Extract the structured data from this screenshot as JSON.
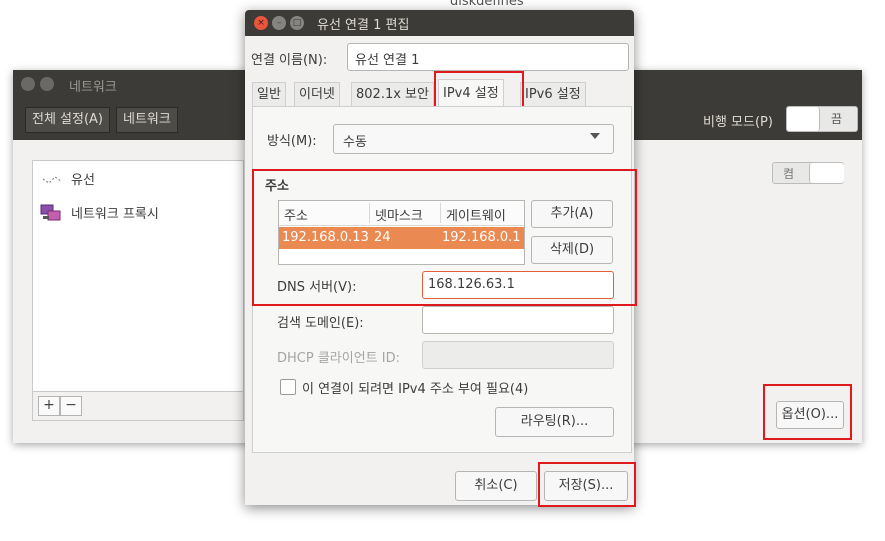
{
  "background_window": {
    "partial_title": "diskdefines",
    "title": "네트워크",
    "toolbar": {
      "all_settings": "전체 설정(A)",
      "network": "네트워크"
    },
    "airplane_mode": {
      "label": "비행 모드(P)",
      "state": "끔"
    },
    "sidebar": {
      "items": [
        {
          "label": "유선"
        },
        {
          "label": "네트워크 프록시"
        }
      ],
      "add": "+",
      "remove": "−"
    },
    "wired_toggle": {
      "state": "켬"
    },
    "options_button": "옵션(O)..."
  },
  "dialog": {
    "title": "유선 연결 1 편집",
    "connection_name": {
      "label": "연결 이름(N):",
      "value": "유선 연결 1"
    },
    "tabs": [
      {
        "label": "일반"
      },
      {
        "label": "이더넷"
      },
      {
        "label": "802.1x 보안"
      },
      {
        "label": "IPv4 설정",
        "active": true
      },
      {
        "label": "IPv6 설정"
      }
    ],
    "method": {
      "label": "방식(M):",
      "value": "수동"
    },
    "addresses": {
      "section_title": "주소",
      "columns": [
        "주소",
        "넷마스크",
        "게이트웨이"
      ],
      "rows": [
        {
          "address": "192.168.0.13",
          "netmask": "24",
          "gateway": "192.168.0.1"
        }
      ],
      "add_button": "추가(A)",
      "delete_button": "삭제(D)"
    },
    "dns": {
      "label": "DNS 서버(V):",
      "value": "168.126.63.1"
    },
    "search_domains": {
      "label": "검색 도메인(E):",
      "value": ""
    },
    "dhcp_client_id": {
      "label": "DHCP 클라이언트 ID:",
      "value": ""
    },
    "require_ipv4": {
      "label": "이 연결이 되려면 IPv4 주소 부여 필요(4)",
      "checked": false
    },
    "routes_button": "라우팅(R)...",
    "cancel_button": "취소(C)",
    "save_button": "저장(S)..."
  },
  "colors": {
    "highlight": "#e0191e",
    "selection": "#ea8a52",
    "titlebar": "#3c3b37",
    "close": "#e8553c"
  }
}
